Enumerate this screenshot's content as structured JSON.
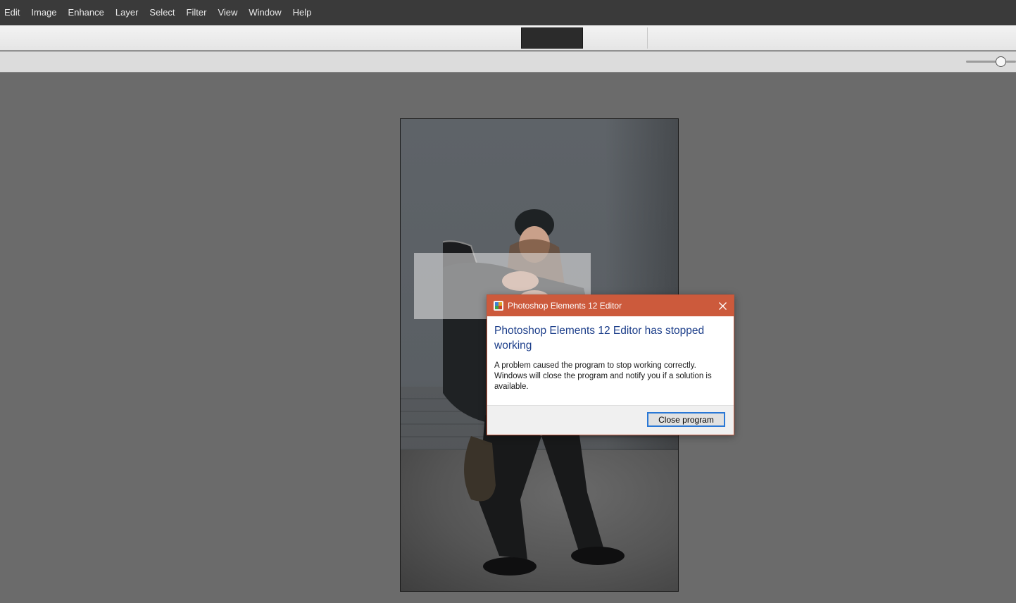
{
  "menubar": {
    "items": [
      {
        "label": "Edit"
      },
      {
        "label": "Image"
      },
      {
        "label": "Enhance"
      },
      {
        "label": "Layer"
      },
      {
        "label": "Select"
      },
      {
        "label": "Filter"
      },
      {
        "label": "View"
      },
      {
        "label": "Window"
      },
      {
        "label": "Help"
      }
    ]
  },
  "toolbar": {
    "zoom_level": 0.7
  },
  "dialog": {
    "title": "Photoshop Elements 12 Editor",
    "heading": "Photoshop Elements 12 Editor has stopped working",
    "message": "A problem caused the program to stop working correctly. Windows will close the program and notify you if a solution is available.",
    "close_button": "Close program",
    "accent_color": "#cc5a3c",
    "heading_color": "#1c3e8a"
  },
  "icons": {
    "app": "photoshop-elements-app-icon",
    "close": "close-icon"
  }
}
